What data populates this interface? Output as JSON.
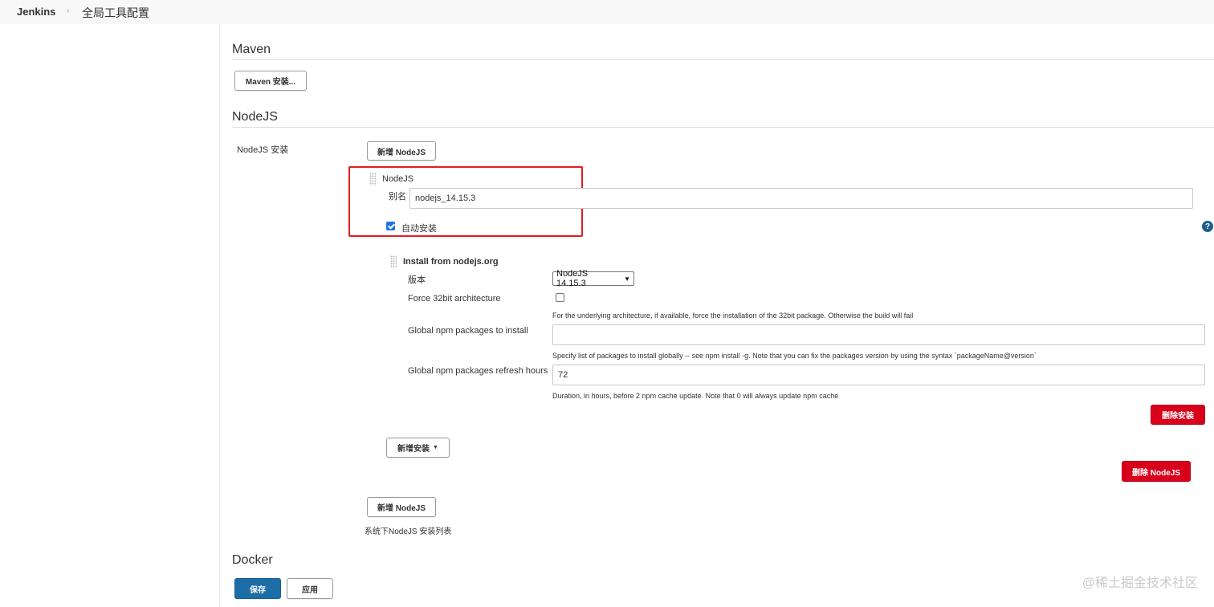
{
  "breadcrumb": {
    "brand": "Jenkins",
    "separator": "›",
    "current": "全局工具配置"
  },
  "maven": {
    "title": "Maven",
    "install_button": "Maven 安装..."
  },
  "nodejs": {
    "title": "NodeJS",
    "installations_label": "NodeJS 安装",
    "add_button": "新增 NodeJS",
    "installation": {
      "header": "NodeJS",
      "alias_label": "别名",
      "alias_value": "nodejs_14.15.3",
      "auto_install_label": "自动安装",
      "auto_install_checked": true,
      "installer": {
        "title": "Install from nodejs.org",
        "version_label": "版本",
        "version_value": "NodeJS 14.15.3",
        "force32_label": "Force 32bit architecture",
        "force32_checked": false,
        "force32_desc": "For the underlying architecture, if available, force the installation of the 32bit package. Otherwise the build will fail",
        "global_pkgs_label": "Global npm packages to install",
        "global_pkgs_value": "",
        "global_pkgs_desc": "Specify list of packages to install globally -- see npm install -g. Note that you can fix the packages version by using the syntax `packageName@version`",
        "refresh_label": "Global npm packages refresh hours",
        "refresh_value": "72",
        "refresh_desc": "Duration, in hours, before 2 npm cache update. Note that 0 will always update npm cache",
        "delete_installer_button": "删除安装"
      },
      "add_installer_button": "新增安装",
      "delete_nodejs_button": "删除 NodeJS"
    },
    "add_button_bottom": "新增 NodeJS",
    "list_hint": "系统下NodeJS 安装列表"
  },
  "docker": {
    "title": "Docker"
  },
  "footer": {
    "save_button": "保存",
    "apply_button": "应用"
  },
  "help_icon_glyph": "?",
  "watermark": "@稀土掘金技术社区",
  "colors": {
    "danger": "#d9001b",
    "primary": "#1d6ea7",
    "highlight": "#e02020"
  }
}
